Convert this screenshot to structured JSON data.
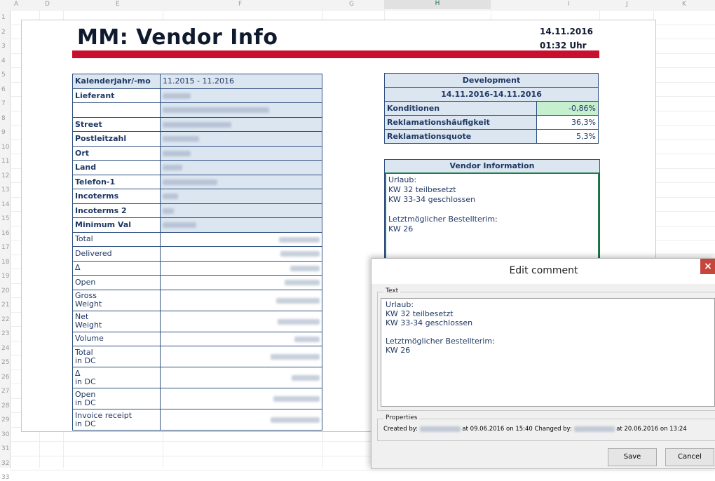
{
  "spreadsheet": {
    "columns": [
      "A",
      "D",
      "E",
      "F",
      "G",
      "H",
      "I",
      "J",
      "K"
    ],
    "rows": [
      "1",
      "2",
      "3",
      "4",
      "5",
      "6",
      "7",
      "8",
      "9",
      "10",
      "11",
      "12",
      "13",
      "14",
      "15",
      "16",
      "17",
      "18",
      "19",
      "20",
      "21",
      "22",
      "23",
      "24",
      "25",
      "26",
      "27",
      "28",
      "29",
      "30",
      "31",
      "32",
      "33"
    ]
  },
  "report": {
    "title": "MM: Vendor Info",
    "date": "14.11.2016",
    "time": "01:32 Uhr"
  },
  "vendor_table": {
    "header_label": "Kalenderjahr/-mo",
    "header_value": "11.2015 - 11.2016",
    "rows": [
      {
        "label": "Lieferant",
        "bold": true
      },
      {
        "label": "",
        "bold": false
      },
      {
        "label": "Street",
        "bold": true
      },
      {
        "label": "Postleitzahl",
        "bold": true
      },
      {
        "label": "Ort",
        "bold": true
      },
      {
        "label": "Land",
        "bold": true
      },
      {
        "label": "Telefon-1",
        "bold": true
      },
      {
        "label": "Incoterms",
        "bold": true
      },
      {
        "label": "Incoterms 2",
        "bold": true
      },
      {
        "label": "Minimum Val",
        "bold": true
      }
    ],
    "metric_rows": [
      {
        "line1": "Total",
        "line2": ""
      },
      {
        "line1": "Delivered",
        "line2": ""
      },
      {
        "line1": "Δ",
        "line2": ""
      },
      {
        "line1": "Open",
        "line2": ""
      },
      {
        "line1": "Gross",
        "line2": "Weight"
      },
      {
        "line1": "Net",
        "line2": "Weight"
      },
      {
        "line1": "Volume",
        "line2": ""
      },
      {
        "line1": "Total",
        "line2": "in DC"
      },
      {
        "line1": "Δ",
        "line2": "in DC"
      },
      {
        "line1": "Open",
        "line2": "in DC"
      },
      {
        "line1": "Invoice receipt",
        "line2": "in DC"
      }
    ]
  },
  "development": {
    "title": "Development",
    "period": "14.11.2016-14.11.2016",
    "rows": [
      {
        "label": "Konditionen",
        "value": "-0,86%"
      },
      {
        "label": "Reklamationshäufigkeit",
        "value": "36,3%"
      },
      {
        "label": "Reklamationsquote",
        "value": "5,3%"
      }
    ],
    "highlight_color": "#c6efce"
  },
  "vendor_information": {
    "title": "Vendor Information",
    "lines": [
      "Urlaub:",
      "KW 32 teilbesetzt",
      "KW 33-34 geschlossen",
      "",
      "Letztmöglicher Bestellterim:",
      "KW 26"
    ]
  },
  "dialog": {
    "title": "Edit comment",
    "close_glyph": "×",
    "text_group_label": "Text",
    "text_lines": [
      "Urlaub:",
      "KW 32 teilbesetzt",
      "KW 33-34 geschlossen",
      "",
      "Letztmöglicher Bestellterim:",
      "KW 26"
    ],
    "properties_label": "Properties",
    "created_prefix": "Created by:",
    "created_suffix": "at 09.06.2016 on 15:40 Changed by:",
    "changed_suffix": "at 20.06.2016 on 13:24",
    "save_label": "Save",
    "cancel_label": "Cancel"
  },
  "colors": {
    "accent_red": "#c8102e",
    "table_fill": "#dce6f1",
    "border_blue": "#2f4f7f",
    "close_red": "#c7453a"
  }
}
